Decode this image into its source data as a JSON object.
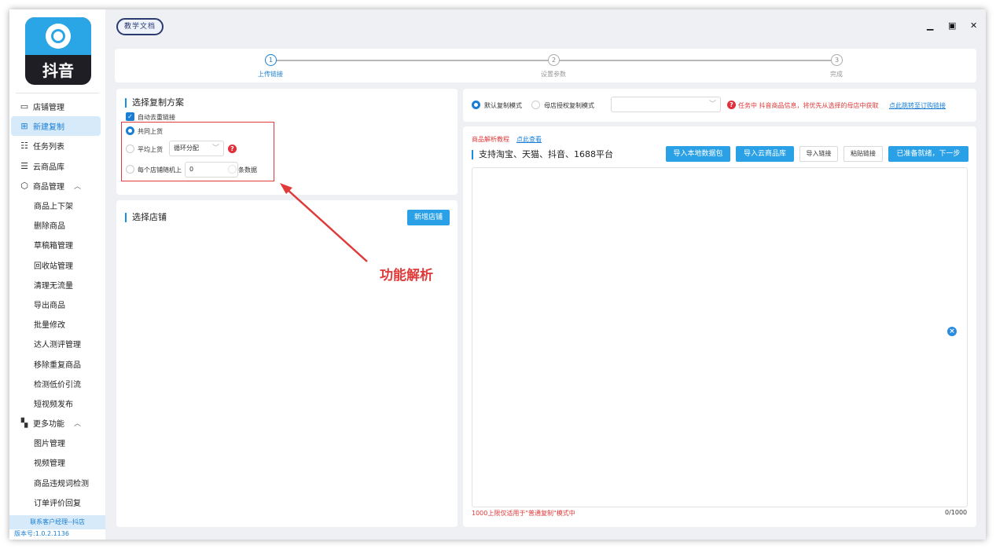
{
  "app": {
    "logo_text": "抖音",
    "doc_button": "教学文档",
    "controls": {
      "minimize": "▁",
      "maximize": "▣",
      "close": "✕"
    }
  },
  "sidebar": {
    "items": [
      {
        "label": "店铺管理",
        "icon": "store-icon"
      },
      {
        "label": "新建复制",
        "icon": "add-copy-icon",
        "active": true
      },
      {
        "label": "任务列表",
        "icon": "task-list-icon"
      },
      {
        "label": "云商品库",
        "icon": "cloud-library-icon"
      },
      {
        "label": "商品管理",
        "icon": "box-icon",
        "expandable": true
      },
      {
        "label": "商品上下架",
        "sub": true
      },
      {
        "label": "删除商品",
        "sub": true
      },
      {
        "label": "草稿箱管理",
        "sub": true
      },
      {
        "label": "回收站管理",
        "sub": true
      },
      {
        "label": "清理无流量",
        "sub": true
      },
      {
        "label": "导出商品",
        "sub": true
      },
      {
        "label": "批量修改",
        "sub": true
      },
      {
        "label": "达人测评管理",
        "sub": true
      },
      {
        "label": "移除重复商品",
        "sub": true
      },
      {
        "label": "检测低价引流",
        "sub": true
      },
      {
        "label": "短视频发布",
        "sub": true
      },
      {
        "label": "更多功能",
        "icon": "grid-icon",
        "expandable": true
      },
      {
        "label": "图片管理",
        "sub": true
      },
      {
        "label": "视频管理",
        "sub": true
      },
      {
        "label": "商品违规词检测",
        "sub": true
      },
      {
        "label": "订单评价回复",
        "sub": true
      }
    ],
    "contact": "联系客户经理--抖店",
    "version": "版本号:1.0.2.1136"
  },
  "steps": [
    {
      "num": "1",
      "label": "上传链接",
      "active": true
    },
    {
      "num": "2",
      "label": "设置参数",
      "active": false
    },
    {
      "num": "3",
      "label": "完成",
      "active": false
    }
  ],
  "copy_plan": {
    "title": "选择复制方案",
    "auto_dedupe": "自动去重链接",
    "option_shared": "共同上货",
    "option_average": "平均上货",
    "average_select": "循环分配",
    "option_random_prefix": "每个店铺随机上",
    "random_value": "0",
    "option_random_suffix": "条数据"
  },
  "store": {
    "title": "选择店铺",
    "add_button": "新增店铺"
  },
  "mode": {
    "default_mode": "默认复制模式",
    "auth_mode": "母店授权复制模式",
    "select_value": "",
    "warning": "任务中 抖音商品信息，将优先从选择的母店中获取",
    "warning_link": "点此跳转至订购链接"
  },
  "parse": {
    "tutorial": "商品解析教程",
    "tutorial_link": "点此查看",
    "platforms": "支持淘宝、天猫、抖音、1688平台",
    "btn_import_local": "导入本地数据包",
    "btn_import_cloud": "导入云商品库",
    "btn_import_link": "导入链接",
    "btn_paste_link": "粘贴链接",
    "btn_next": "已准备就绪，下一步",
    "limit_note": "1000上限仅适用于\"普通复制\"模式中",
    "counter": "0/1000"
  },
  "annotation": "功能解析",
  "colors": {
    "accent": "#1a7fd4",
    "button": "#2aa0e6",
    "warning": "#e03a3a"
  }
}
